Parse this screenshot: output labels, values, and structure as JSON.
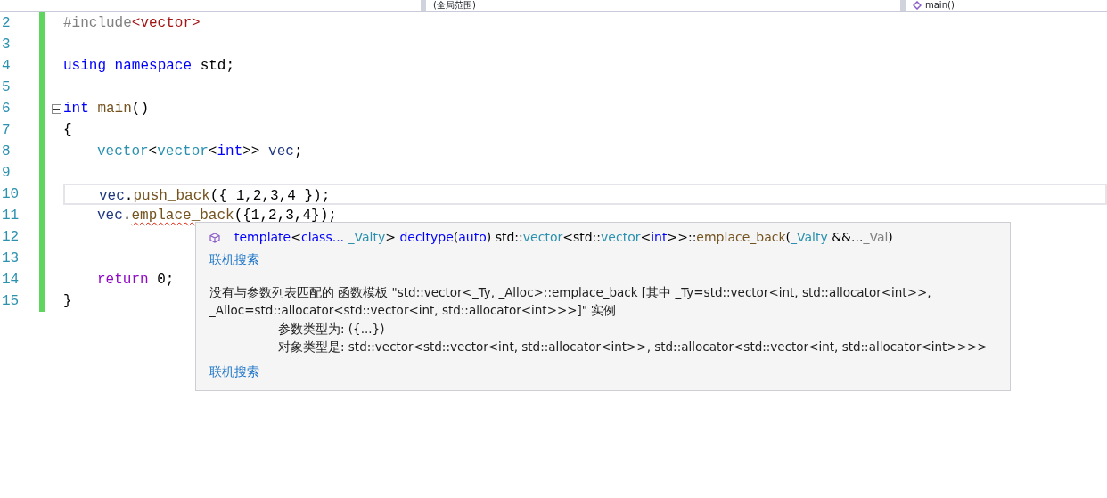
{
  "nav_bar": {
    "scope": "(全局范围)",
    "member": "main()"
  },
  "code_lines": [
    {
      "number": "2",
      "indented": false,
      "fold": false,
      "current": false,
      "tokens": [
        {
          "text": "#include",
          "kind": "preprocessor"
        },
        {
          "text": "<vector>",
          "kind": "string"
        }
      ]
    },
    {
      "number": "3",
      "indented": false,
      "fold": false,
      "current": false
    },
    {
      "number": "4",
      "indented": false,
      "fold": false,
      "current": false,
      "tokens": [
        {
          "text": "using",
          "kind": "keyword"
        },
        {
          "text": " namespace",
          "kind": "keyword"
        },
        {
          "text": " std;",
          "kind": "plain"
        }
      ]
    },
    {
      "number": "5",
      "indented": false,
      "fold": false,
      "current": false
    },
    {
      "number": "6",
      "indented": false,
      "fold": true,
      "current": false,
      "tokens": [
        {
          "text": "int",
          "kind": "keyword"
        },
        {
          "text": " main",
          "kind": "function"
        },
        {
          "text": "()",
          "kind": "plain"
        }
      ]
    },
    {
      "number": "7",
      "indented": false,
      "fold": false,
      "current": false,
      "tokens": [
        {
          "text": "{",
          "kind": "plain"
        }
      ]
    },
    {
      "number": "8",
      "indented": true,
      "fold": false,
      "current": false,
      "tokens": [
        {
          "text": "vector",
          "kind": "type"
        },
        {
          "text": "<",
          "kind": "plain"
        },
        {
          "text": "vector",
          "kind": "type"
        },
        {
          "text": "<",
          "kind": "plain"
        },
        {
          "text": "int",
          "kind": "keyword"
        },
        {
          "text": ">> ",
          "kind": "plain"
        },
        {
          "text": "vec",
          "kind": "variable"
        },
        {
          "text": ";",
          "kind": "plain"
        }
      ]
    },
    {
      "number": "9",
      "indented": false,
      "fold": false,
      "current": false
    },
    {
      "number": "10",
      "indented": true,
      "fold": false,
      "current": true,
      "tokens": [
        {
          "text": "vec",
          "kind": "variable"
        },
        {
          "text": ".",
          "kind": "plain"
        },
        {
          "text": "push_back",
          "kind": "function"
        },
        {
          "text": "({ 1,2,3,4 });",
          "kind": "plain"
        }
      ]
    },
    {
      "number": "11",
      "indented": true,
      "fold": false,
      "current": false,
      "tokens": [
        {
          "text": "vec",
          "kind": "variable"
        },
        {
          "text": ".",
          "kind": "plain"
        },
        {
          "text": "emplace_back",
          "kind": "function",
          "error": true
        },
        {
          "text": "({1,2,3,4});",
          "kind": "plain"
        }
      ]
    },
    {
      "number": "12",
      "indented": false,
      "fold": false,
      "current": false
    },
    {
      "number": "13",
      "indented": false,
      "fold": false,
      "current": false
    },
    {
      "number": "14",
      "indented": true,
      "fold": false,
      "current": false,
      "tokens": [
        {
          "text": "return",
          "kind": "control"
        },
        {
          "text": " 0;",
          "kind": "plain"
        }
      ]
    },
    {
      "number": "15",
      "indented": false,
      "fold": false,
      "current": false,
      "tokens": [
        {
          "text": "}",
          "kind": "plain"
        }
      ]
    }
  ],
  "tooltip": {
    "signature": [
      {
        "text": "template",
        "kind": "keyword"
      },
      {
        "text": "<",
        "kind": "plain"
      },
      {
        "text": "class...",
        "kind": "keyword"
      },
      {
        "text": " _Valty",
        "kind": "type"
      },
      {
        "text": "> ",
        "kind": "plain"
      },
      {
        "text": "decltype",
        "kind": "keyword"
      },
      {
        "text": "(",
        "kind": "plain"
      },
      {
        "text": "auto",
        "kind": "keyword"
      },
      {
        "text": ") std::",
        "kind": "plain"
      },
      {
        "text": "vector",
        "kind": "type"
      },
      {
        "text": "<std::",
        "kind": "plain"
      },
      {
        "text": "vector",
        "kind": "type"
      },
      {
        "text": "<",
        "kind": "plain"
      },
      {
        "text": "int",
        "kind": "keyword"
      },
      {
        "text": ">>::",
        "kind": "plain"
      },
      {
        "text": "emplace_back",
        "kind": "function"
      },
      {
        "text": "(",
        "kind": "plain"
      },
      {
        "text": "_Valty",
        "kind": "type"
      },
      {
        "text": " &&...",
        "kind": "plain"
      },
      {
        "text": "_Val",
        "kind": "parameter"
      },
      {
        "text": ")",
        "kind": "plain"
      }
    ],
    "search_link": "联机搜索",
    "message": "没有与参数列表匹配的 函数模板 \"std::vector<_Ty, _Alloc>::emplace_back [其中 _Ty=std::vector<int, std::allocator<int>>, _Alloc=std::allocator<std::vector<int, std::allocator<int>>>]\" 实例",
    "details": [
      "参数类型为:  ({...})",
      "对象类型是:  std::vector<std::vector<int, std::allocator<int>>, std::allocator<std::vector<int, std::allocator<int>>>>"
    ],
    "footer_link": "联机搜索"
  }
}
